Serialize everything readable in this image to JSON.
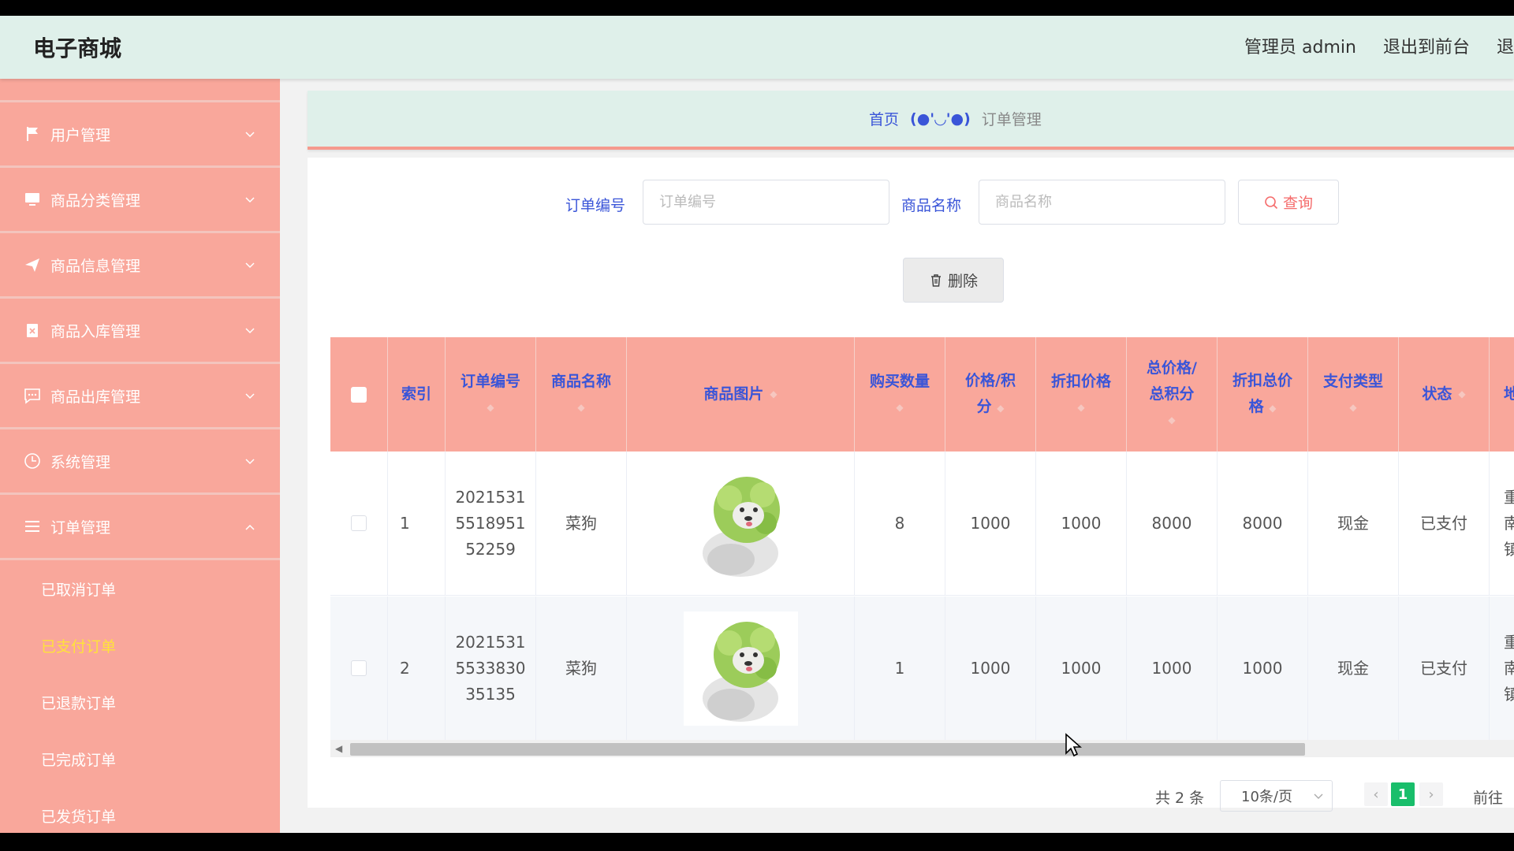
{
  "header": {
    "brand": "电子商城",
    "admin_label": "管理员 admin",
    "exit_front": "退出到前台",
    "exit_partial": "退"
  },
  "sidebar": {
    "items": [
      {
        "label": "用户管理",
        "icon": "flag-icon"
      },
      {
        "label": "商品分类管理",
        "icon": "monitor-icon"
      },
      {
        "label": "商品信息管理",
        "icon": "send-icon"
      },
      {
        "label": "商品入库管理",
        "icon": "clipboard-icon"
      },
      {
        "label": "商品出库管理",
        "icon": "chat-icon"
      },
      {
        "label": "系统管理",
        "icon": "clock-icon"
      },
      {
        "label": "订单管理",
        "icon": "list-icon",
        "expanded": true
      }
    ],
    "submenu": [
      {
        "label": "已取消订单"
      },
      {
        "label": "已支付订单",
        "active": true
      },
      {
        "label": "已退款订单"
      },
      {
        "label": "已完成订单"
      },
      {
        "label": "已发货订单"
      }
    ]
  },
  "breadcrumb": {
    "home": "首页",
    "separator": "(●'◡'●)",
    "current": "订单管理"
  },
  "search": {
    "order_no_label": "订单编号",
    "order_no_placeholder": "订单编号",
    "product_label": "商品名称",
    "product_placeholder": "商品名称",
    "query_button": "查询",
    "delete_button": "删除"
  },
  "table": {
    "headers": {
      "index": "索引",
      "order_no": "订单编号",
      "product_name": "商品名称",
      "product_image": "商品图片",
      "quantity": "购买数量",
      "price_l1": "价格/积",
      "price_l2": "分",
      "discount_price": "折扣价格",
      "total_l1": "总价格/",
      "total_l2": "总积分",
      "discount_total_l1": "折扣总价",
      "discount_total_l2": "格",
      "pay_type": "支付类型",
      "status": "状态",
      "extra": "地"
    },
    "rows": [
      {
        "index": "1",
        "order_no_1": "2021531",
        "order_no_2": "5518951",
        "order_no_3": "52259",
        "product_name": "菜狗",
        "quantity": "8",
        "price": "1000",
        "discount_price": "1000",
        "total": "8000",
        "discount_total": "8000",
        "pay_type": "现金",
        "status": "已支付",
        "extra_1": "重",
        "extra_2": "南",
        "extra_3": "镇"
      },
      {
        "index": "2",
        "order_no_1": "2021531",
        "order_no_2": "5533830",
        "order_no_3": "35135",
        "product_name": "菜狗",
        "quantity": "1",
        "price": "1000",
        "discount_price": "1000",
        "total": "1000",
        "discount_total": "1000",
        "pay_type": "现金",
        "status": "已支付",
        "extra_1": "重",
        "extra_2": "南",
        "extra_3": "镇"
      }
    ]
  },
  "pagination": {
    "total": "共 2 条",
    "page_size": "10条/页",
    "current_page": "1",
    "goto_label": "前往"
  },
  "colors": {
    "header_bg": "#dff0ea",
    "sidebar_bg": "#f9a79b",
    "accent_blue": "#3a55d8",
    "active_yellow": "#ffe23b",
    "page_green": "#19be6b"
  },
  "caption": "…"
}
